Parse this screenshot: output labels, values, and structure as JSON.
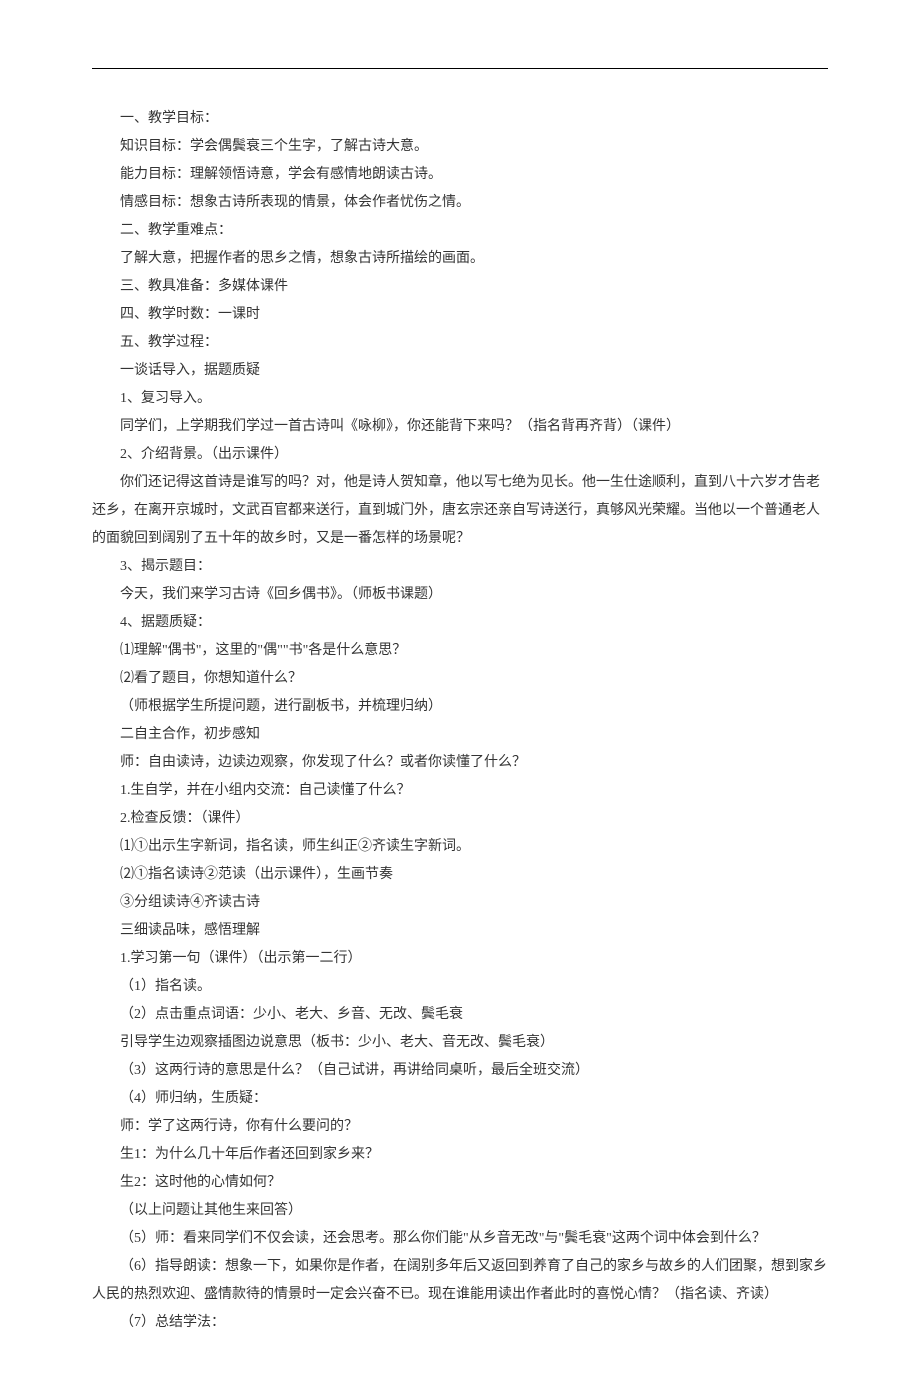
{
  "lines": [
    "一、教学目标：",
    "知识目标：学会偶鬓衰三个生字，了解古诗大意。",
    "能力目标：理解领悟诗意，学会有感情地朗读古诗。",
    "情感目标：想象古诗所表现的情景，体会作者忧伤之情。",
    "二、教学重难点：",
    "了解大意，把握作者的思乡之情，想象古诗所描绘的画面。",
    "三、教具准备：多媒体课件",
    "四、教学时数：一课时",
    "五、教学过程：",
    "一谈话导入，据题质疑",
    "1、复习导入。",
    "同学们，上学期我们学过一首古诗叫《咏柳》，你还能背下来吗？（指名背再齐背）（课件）",
    "2、介绍背景。（出示课件）",
    "你们还记得这首诗是谁写的吗？对，他是诗人贺知章，他以写七绝为见长。他一生仕途顺利，直到八十六岁才告老还乡，在离开京城时，文武百官都来送行，直到城门外，唐玄宗还亲自写诗送行，真够风光荣耀。当他以一个普通老人的面貌回到阔别了五十年的故乡时，又是一番怎样的场景呢？",
    "3、揭示题目：",
    "今天，我们来学习古诗《回乡偶书》。（师板书课题）",
    "4、据题质疑：",
    "⑴理解\"偶书\"，这里的\"偶\"\"书\"各是什么意思？",
    "⑵看了题目，你想知道什么？",
    "（师根据学生所提问题，进行副板书，并梳理归纳）",
    "二自主合作，初步感知",
    "师：自由读诗，边读边观察，你发现了什么？或者你读懂了什么？",
    "1.生自学，并在小组内交流：自己读懂了什么？",
    "2.检查反馈：（课件）",
    "⑴①出示生字新词，指名读，师生纠正②齐读生字新词。",
    "⑵①指名读诗②范读（出示课件），生画节奏",
    "③分组读诗④齐读古诗",
    "三细读品味，感悟理解",
    "1.学习第一句（课件）（出示第一二行）",
    "（1）指名读。",
    "（2）点击重点词语：少小、老大、乡音、无改、鬓毛衰",
    "引导学生边观察插图边说意思（板书：少小、老大、音无改、鬓毛衰）",
    "（3）这两行诗的意思是什么？（自己试讲，再讲给同桌听，最后全班交流）",
    "（4）师归纳，生质疑：",
    "师：学了这两行诗，你有什么要问的？",
    "生1：为什么几十年后作者还回到家乡来？",
    "生2：这时他的心情如何？",
    "（以上问题让其他生来回答）",
    "（5）师：看来同学们不仅会读，还会思考。那么你们能\"从乡音无改\"与\"鬓毛衰\"这两个词中体会到什么？",
    "（6）指导朗读：想象一下，如果你是作者，在阔别多年后又返回到养育了自己的家乡与故乡的人们团聚，想到家乡人民的热烈欢迎、盛情款待的情景时一定会兴奋不已。现在谁能用读出作者此时的喜悦心情？（指名读、齐读）",
    "（7）总结学法："
  ]
}
